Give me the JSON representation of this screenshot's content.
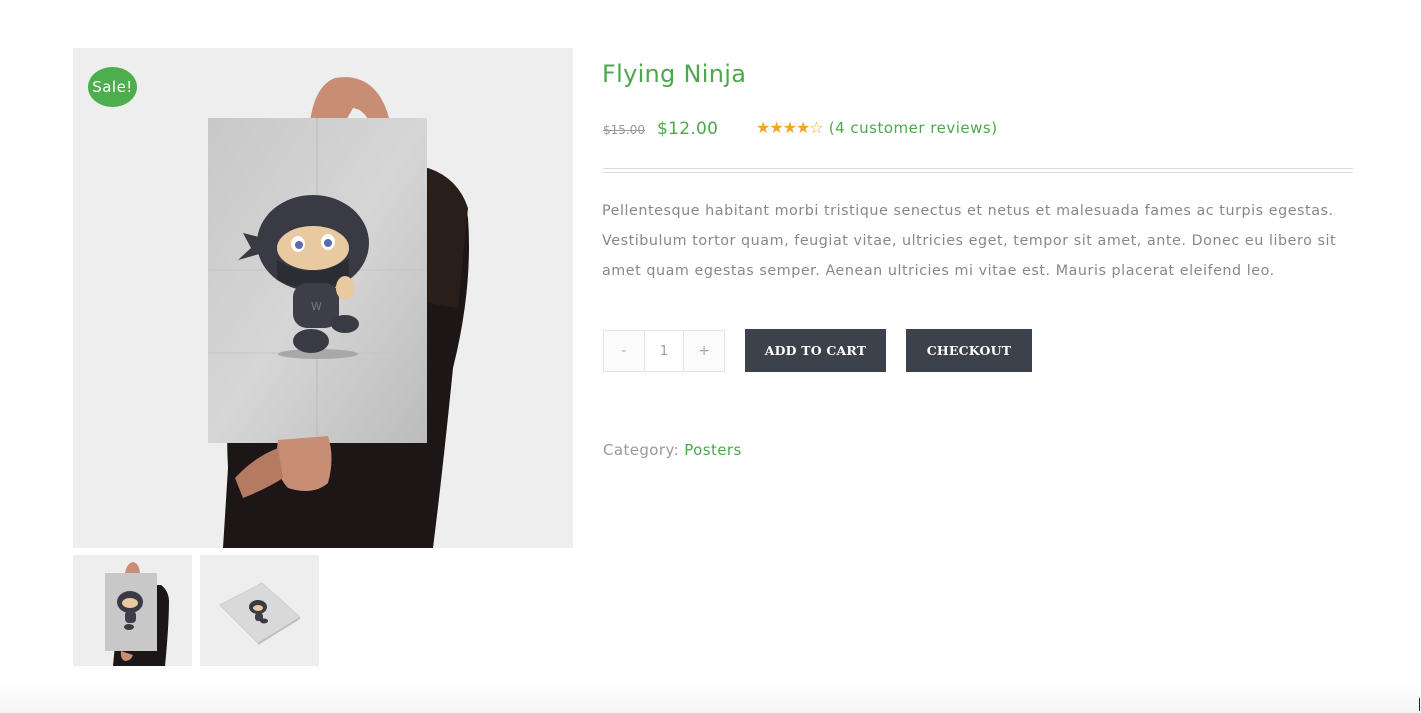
{
  "product": {
    "title": "Flying Ninja",
    "sale_badge": "Sale!",
    "price_old": "$15.00",
    "price_new": "$12.00",
    "rating": 4,
    "rating_max": 5,
    "stars": "★★★★☆",
    "reviews_label": "(4 customer reviews)",
    "description": "Pellentesque habitant morbi tristique senectus et netus et malesuada fames ac turpis egestas. Vestibulum tortor quam, feugiat vitae, ultricies eget, tempor sit amet, ante. Donec eu libero sit amet quam egestas semper. Aenean ultricies mi vitae est. Mauris placerat eleifend leo."
  },
  "cart": {
    "minus_label": "-",
    "quantity": "1",
    "plus_label": "+",
    "add_to_cart_label": "ADD TO CART",
    "checkout_label": "CHECKOUT"
  },
  "meta": {
    "category_label": "Category:",
    "category_value": "Posters"
  },
  "colors": {
    "accent": "#4ca84c",
    "sale_badge": "#4cae4c",
    "button": "#3b424b",
    "stars": "#f2a623",
    "muted_text": "#888888"
  }
}
